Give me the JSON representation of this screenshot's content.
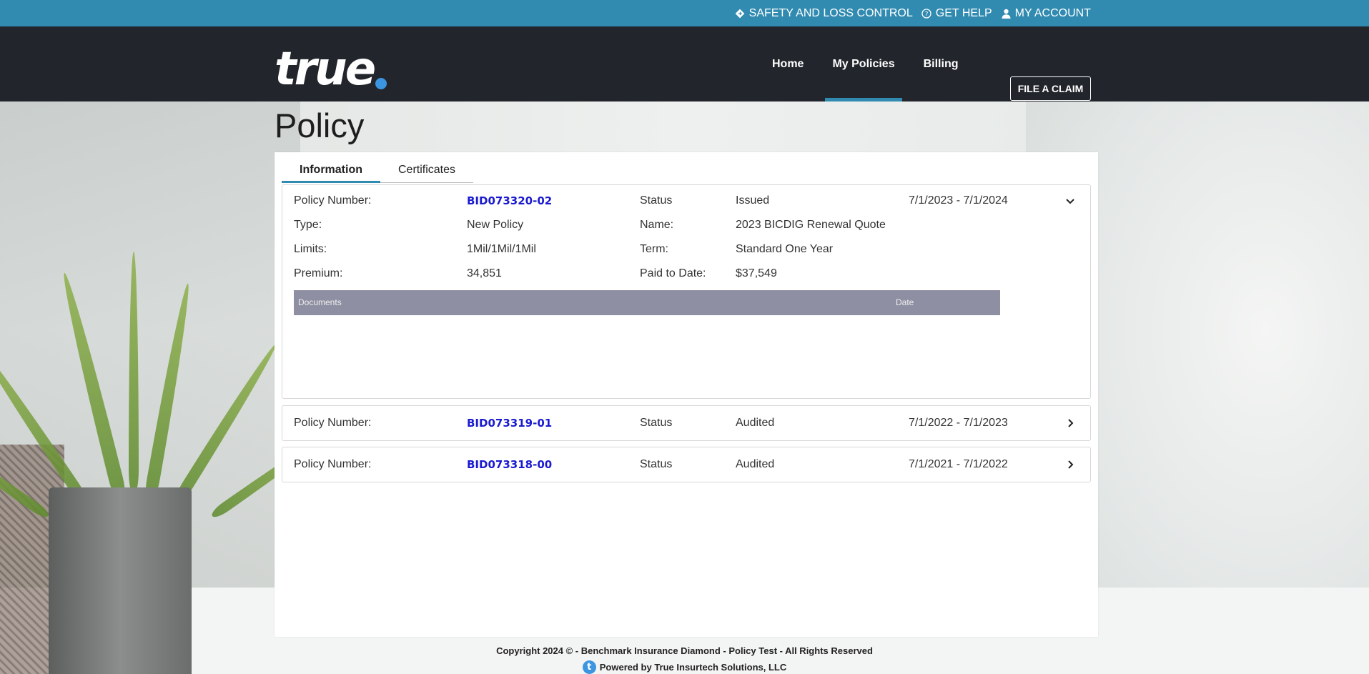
{
  "topbar": {
    "links": [
      {
        "label": "SAFETY AND LOSS CONTROL",
        "icon": "diamond-sign-icon"
      },
      {
        "label": "GET HELP",
        "icon": "help-circle-icon"
      },
      {
        "label": "MY ACCOUNT",
        "icon": "user-icon"
      }
    ]
  },
  "header": {
    "logo_text": "true",
    "nav": [
      {
        "label": "Home",
        "active": false
      },
      {
        "label": "My Policies",
        "active": true
      },
      {
        "label": "Billing",
        "active": false
      }
    ],
    "claim_button": "FILE A CLAIM"
  },
  "page": {
    "title": "Policy",
    "tabs": [
      {
        "label": "Information",
        "active": true
      },
      {
        "label": "Certificates",
        "active": false
      }
    ]
  },
  "policies": [
    {
      "expanded": true,
      "number_label": "Policy Number:",
      "number": "BID073320-02",
      "status_label": "Status",
      "status": "Issued",
      "dates": "7/1/2023 - 7/1/2024",
      "details": {
        "type_label": "Type:",
        "type": "New Policy",
        "name_label": "Name:",
        "name": "2023 BICDIG Renewal Quote",
        "limits_label": "Limits:",
        "limits": "1Mil/1Mil/1Mil",
        "term_label": "Term:",
        "term": "Standard One Year",
        "premium_label": "Premium:",
        "premium": "34,851",
        "paid_label": "Paid to Date:",
        "paid": "$37,549"
      },
      "documents": {
        "col_documents": "Documents",
        "col_date": "Date"
      }
    },
    {
      "expanded": false,
      "number_label": "Policy Number:",
      "number": "BID073319-01",
      "status_label": "Status",
      "status": "Audited",
      "dates": "7/1/2022 - 7/1/2023"
    },
    {
      "expanded": false,
      "number_label": "Policy Number:",
      "number": "BID073318-00",
      "status_label": "Status",
      "status": "Audited",
      "dates": "7/1/2021 - 7/1/2022"
    }
  ],
  "footer": {
    "copyright": "Copyright 2024 © - Benchmark Insurance Diamond - Policy Test - All Rights Reserved",
    "powered": "Powered by True Insurtech Solutions, LLC",
    "powered_logo": "t"
  },
  "colors": {
    "topbar": "#318bb1",
    "header": "#22252b",
    "accent": "#318bb1",
    "link": "#1a1ad0",
    "docs_header": "#8f8fa3",
    "logo_dot": "#3c95e0"
  }
}
